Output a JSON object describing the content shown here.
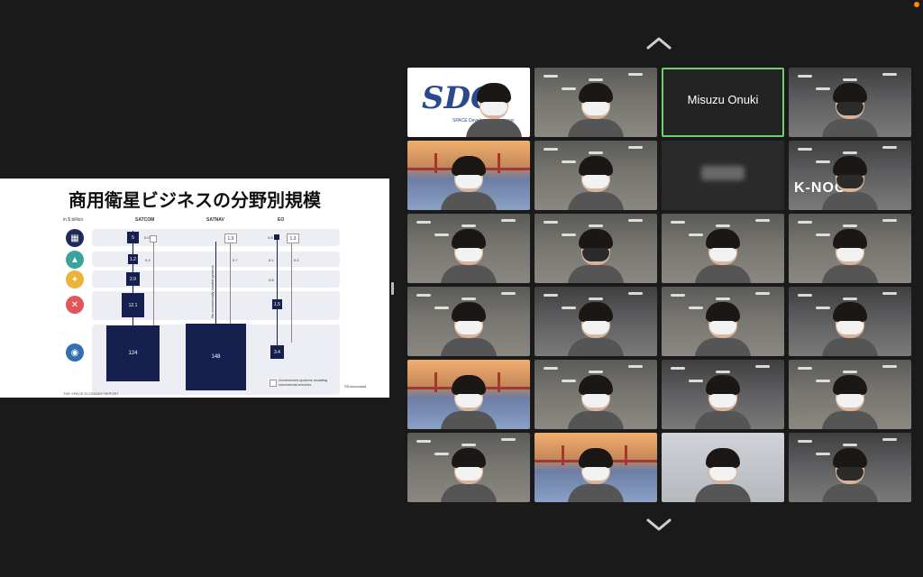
{
  "slide": {
    "title": "商用衛星ビジネスの分野別規模",
    "unit_label": "in $ billion",
    "columns": [
      "SATCOM",
      "SATNAV",
      "EO"
    ],
    "rows": [
      {
        "satcom": "5",
        "satcom_gov": "0.0",
        "eo": "0.8",
        "eo_gov": "1.3",
        "satnav_gov": "1.9"
      },
      {
        "satcom": "1.2",
        "satcom_gov": "0.4",
        "satnav_gov": "0.7",
        "eo": "0.1",
        "eo_gov": "0.4"
      },
      {
        "satcom": "2.9",
        "eo": "0.8"
      },
      {
        "satcom": "12.1",
        "eo": "1.5"
      },
      {
        "satcom": "124",
        "satnav": "148",
        "eo": "3.4"
      }
    ],
    "satnav_note": "No commercially funded systems",
    "legend_note": "Government systems enabling commercial services",
    "source": "©Euroconsult",
    "footer": "THE SPACE ECONOMY REPORT"
  },
  "tiles": [
    {
      "kind": "logo",
      "logo": "SDG",
      "sub": "SPACE Development Gateway"
    },
    {
      "kind": "person",
      "bg": "office",
      "mask": "light"
    },
    {
      "kind": "name",
      "name": "Misuzu Onuki",
      "active": true
    },
    {
      "kind": "person",
      "bg": "office2",
      "mask": "dark"
    },
    {
      "kind": "person",
      "bg": "bay",
      "mask": "light"
    },
    {
      "kind": "person",
      "bg": "office",
      "mask": "light"
    },
    {
      "kind": "blurred"
    },
    {
      "kind": "person",
      "bg": "office2",
      "mask": "dark",
      "sign": "K-NOO"
    },
    {
      "kind": "person",
      "bg": "office",
      "mask": "light"
    },
    {
      "kind": "person",
      "bg": "office",
      "mask": "dark"
    },
    {
      "kind": "person",
      "bg": "office",
      "mask": "light"
    },
    {
      "kind": "person",
      "bg": "office",
      "mask": "light"
    },
    {
      "kind": "person",
      "bg": "office",
      "mask": "light"
    },
    {
      "kind": "person",
      "bg": "office2",
      "mask": "light"
    },
    {
      "kind": "person",
      "bg": "office",
      "mask": "light"
    },
    {
      "kind": "person",
      "bg": "office2",
      "mask": "light"
    },
    {
      "kind": "person",
      "bg": "bay",
      "mask": "light"
    },
    {
      "kind": "person",
      "bg": "office",
      "mask": "light"
    },
    {
      "kind": "person",
      "bg": "office2",
      "mask": "light"
    },
    {
      "kind": "person",
      "bg": "office",
      "mask": "light"
    },
    {
      "kind": "person",
      "bg": "office",
      "mask": "light"
    },
    {
      "kind": "person",
      "bg": "bay",
      "mask": "light"
    },
    {
      "kind": "person",
      "bg": "light",
      "mask": "light"
    },
    {
      "kind": "person",
      "bg": "office2",
      "mask": "dark"
    }
  ],
  "colors": {
    "background": "#1a1a1a",
    "active_border": "#6fcf6f",
    "recording": "#ff8a00",
    "bar": "#15204f"
  }
}
